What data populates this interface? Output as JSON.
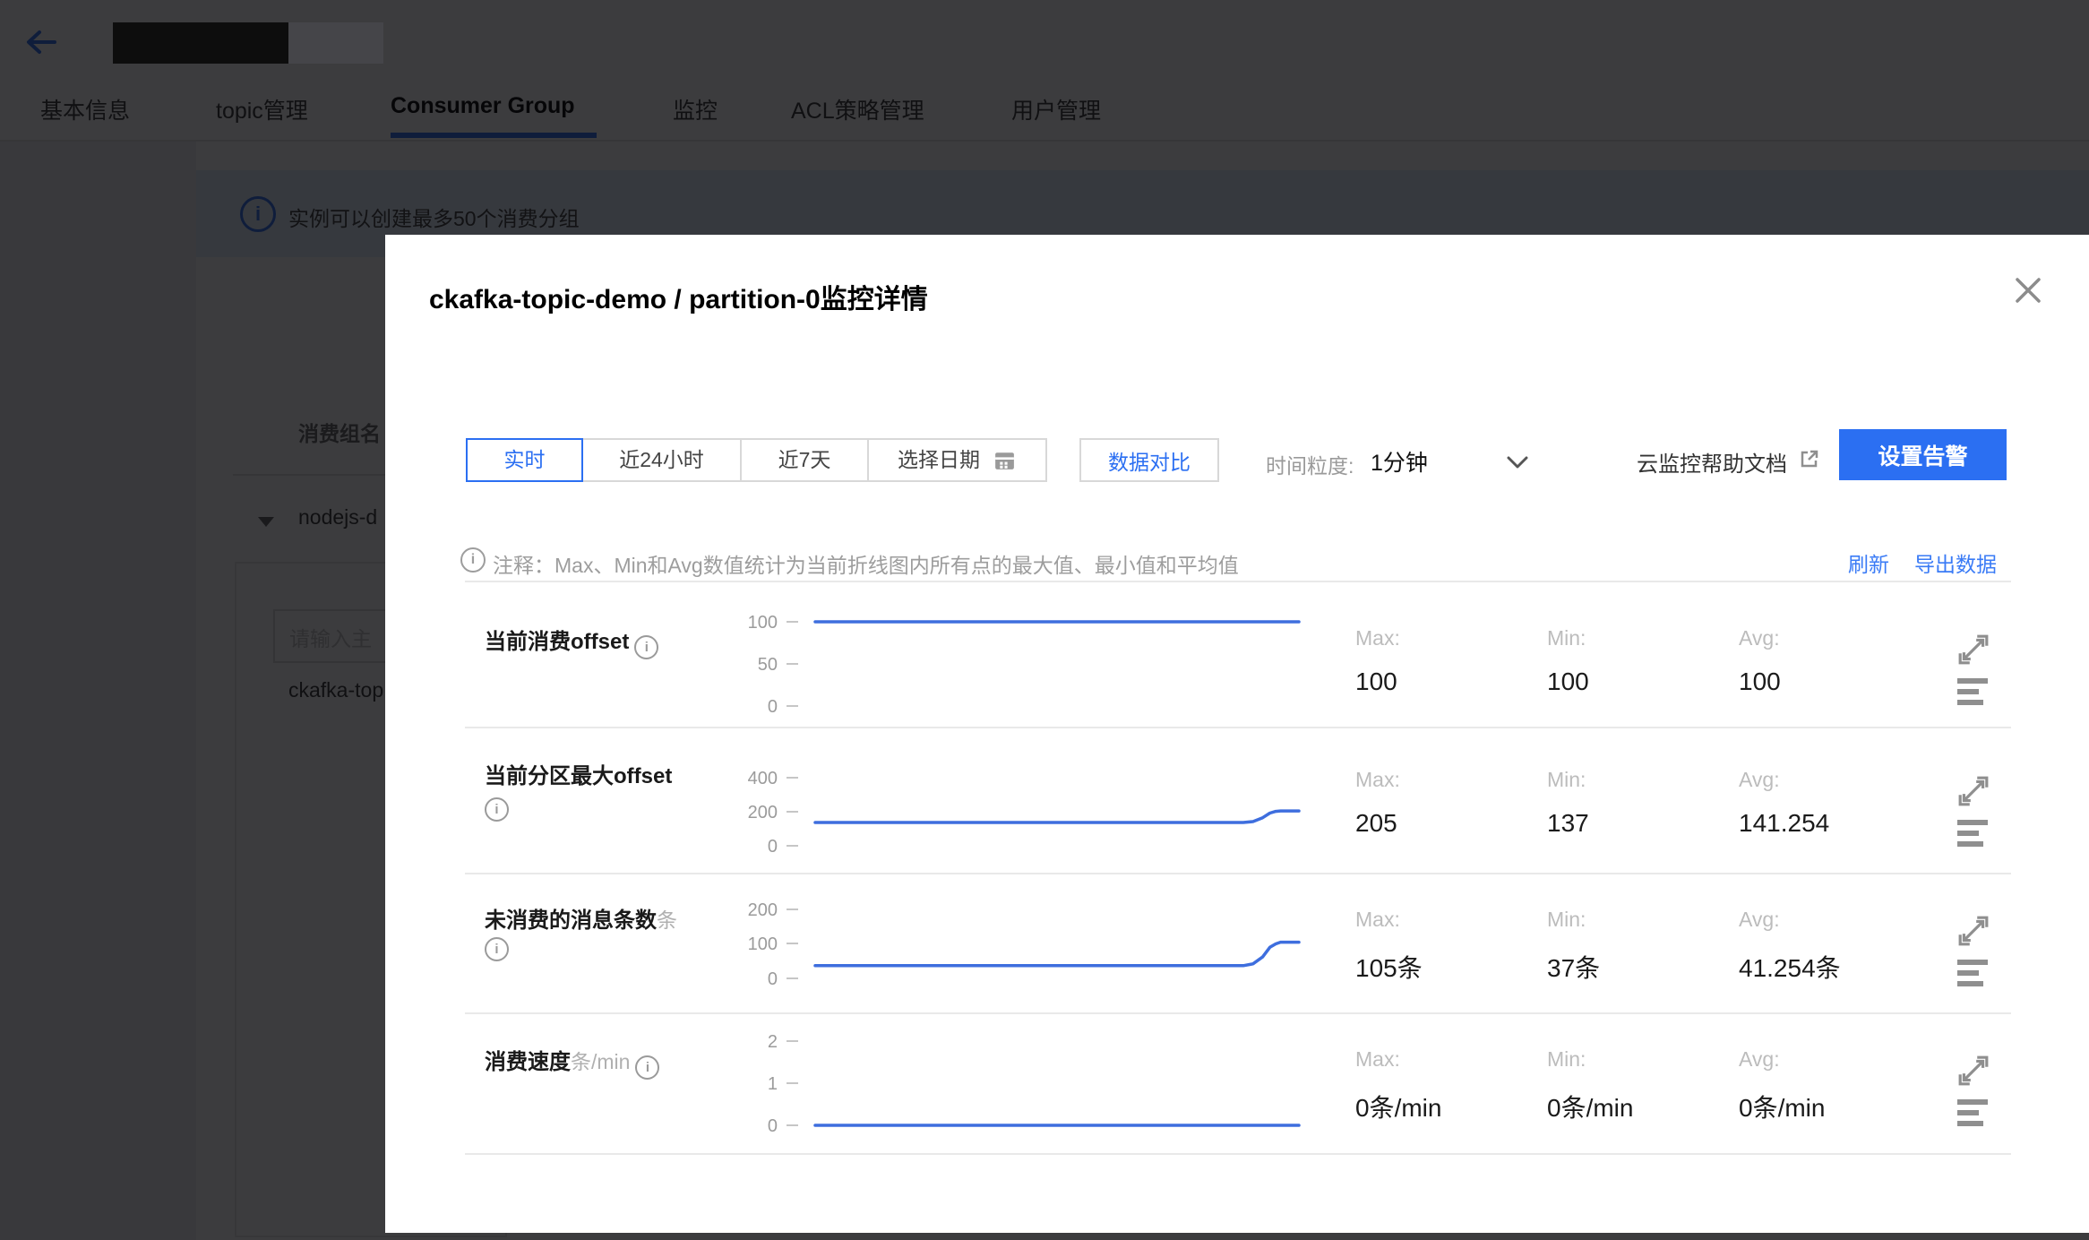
{
  "colors": {
    "accent": "#2b6ff2",
    "chart_line": "#3e6ede",
    "link": "#3a7bf6"
  },
  "page": {
    "tabs": [
      {
        "label": "基本信息",
        "active": false
      },
      {
        "label": "topic管理",
        "active": false
      },
      {
        "label": "Consumer Group",
        "active": true
      },
      {
        "label": "监控",
        "active": false
      },
      {
        "label": "ACL策略管理",
        "active": false
      },
      {
        "label": "用户管理",
        "active": false
      }
    ],
    "banner": {
      "text": "实例可以创建最多50个消费分组"
    },
    "panel": {
      "header": "消费组名",
      "group_name": "nodejs-d",
      "search_placeholder": "请输入主",
      "topic_name": "ckafka-top"
    }
  },
  "modal": {
    "title": "ckafka-topic-demo / partition-0监控详情",
    "time_tabs": [
      "实时",
      "近24小时",
      "近7天",
      "选择日期"
    ],
    "active_time_tab": "实时",
    "compare_button": "数据对比",
    "granularity_label": "时间粒度:",
    "granularity_value": "1分钟",
    "help_link": "云监控帮助文档",
    "alarm_button": "设置告警",
    "note": "注释：Max、Min和Avg数值统计为当前折线图内所有点的最大值、最小值和平均值",
    "refresh": "刷新",
    "export": "导出数据",
    "stats_labels": {
      "max": "Max:",
      "min": "Min:",
      "avg": "Avg:"
    }
  },
  "chart_data": [
    {
      "type": "line",
      "title": "当前消费offset",
      "unit": "",
      "y_ticks": [
        "100",
        "50",
        "0"
      ],
      "ymax": 100,
      "points": [
        [
          0,
          100
        ],
        [
          1,
          100
        ]
      ],
      "max": "100",
      "min": "100",
      "avg": "100",
      "legend_position": "none",
      "grid": false
    },
    {
      "type": "line",
      "title": "当前分区最大offset",
      "unit": "",
      "y_ticks": [
        "400",
        "200",
        "0"
      ],
      "ymax": 400,
      "points": [
        [
          0,
          137
        ],
        [
          0.885,
          137
        ],
        [
          0.905,
          142
        ],
        [
          0.925,
          165
        ],
        [
          0.94,
          192
        ],
        [
          0.952,
          202
        ],
        [
          0.962,
          205
        ],
        [
          1,
          205
        ]
      ],
      "max": "205",
      "min": "137",
      "avg": "141.254",
      "legend_position": "none",
      "grid": false
    },
    {
      "type": "line",
      "title": "未消费的消息条数",
      "unit": "条",
      "y_ticks": [
        "200",
        "100",
        "0"
      ],
      "ymax": 200,
      "points": [
        [
          0,
          37
        ],
        [
          0.885,
          37
        ],
        [
          0.905,
          42
        ],
        [
          0.925,
          62
        ],
        [
          0.94,
          90
        ],
        [
          0.952,
          100
        ],
        [
          0.962,
          105
        ],
        [
          1,
          105
        ]
      ],
      "max": "105条",
      "min": "37条",
      "avg": "41.254条",
      "legend_position": "none",
      "grid": false
    },
    {
      "type": "line",
      "title": "消费速度",
      "unit": "条/min",
      "y_ticks": [
        "2",
        "1",
        "0"
      ],
      "ymax": 2,
      "points": [
        [
          0,
          0
        ],
        [
          1,
          0
        ]
      ],
      "max": "0条/min",
      "min": "0条/min",
      "avg": "0条/min",
      "legend_position": "none",
      "grid": false
    }
  ]
}
